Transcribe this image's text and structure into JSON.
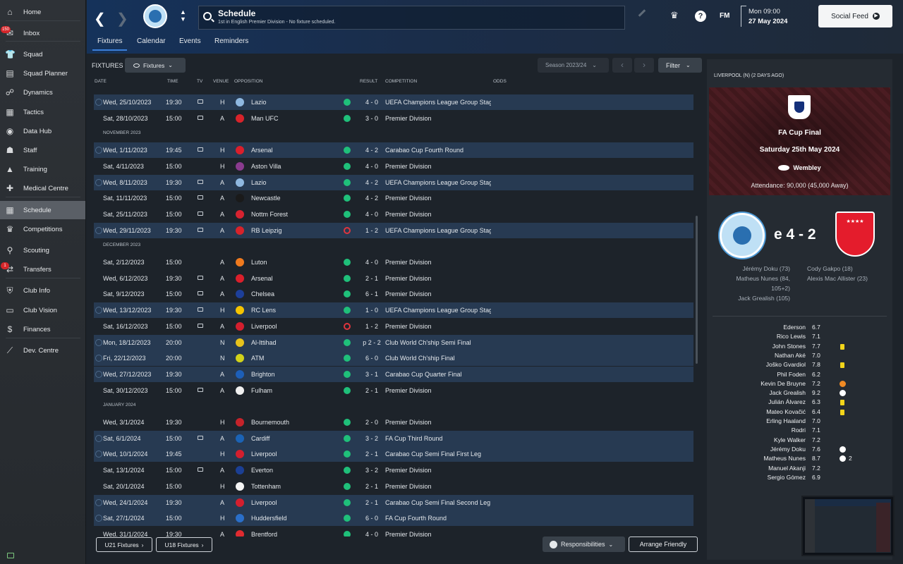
{
  "sidebar": {
    "items": [
      {
        "label": "Home",
        "icon": "home-icon"
      },
      {
        "label": "Inbox",
        "icon": "inbox-icon",
        "badge": "150"
      },
      {
        "label": "Squad",
        "icon": "squad-icon"
      },
      {
        "label": "Squad Planner",
        "icon": "squad-planner-icon"
      },
      {
        "label": "Dynamics",
        "icon": "dynamics-icon"
      },
      {
        "label": "Tactics",
        "icon": "tactics-icon"
      },
      {
        "label": "Data Hub",
        "icon": "data-hub-icon"
      },
      {
        "label": "Staff",
        "icon": "staff-icon"
      },
      {
        "label": "Training",
        "icon": "training-icon"
      },
      {
        "label": "Medical Centre",
        "icon": "medical-icon"
      },
      {
        "label": "Schedule",
        "icon": "schedule-icon",
        "active": true
      },
      {
        "label": "Competitions",
        "icon": "trophy-icon"
      },
      {
        "label": "Scouting",
        "icon": "scouting-icon"
      },
      {
        "label": "Transfers",
        "icon": "transfers-icon",
        "badge": "1"
      },
      {
        "label": "Club Info",
        "icon": "shield-icon"
      },
      {
        "label": "Club Vision",
        "icon": "vision-icon"
      },
      {
        "label": "Finances",
        "icon": "finances-icon"
      },
      {
        "label": "Dev. Centre",
        "icon": "dev-centre-icon"
      }
    ]
  },
  "header": {
    "title": "Schedule",
    "subtitle": "1st in English Premier Division - No fixture scheduled.",
    "fm_logo": "FM",
    "date_time": "Mon 09:00",
    "date_day": "27 May 2024",
    "social_feed": "Social Feed",
    "help": "?"
  },
  "tabs": [
    "Fixtures",
    "Calendar",
    "Events",
    "Reminders"
  ],
  "toolbar": {
    "fixtures_label": "FIXTURES",
    "fixtures_dropdown": "Fixtures",
    "season": "Season 2023/24",
    "filter": "Filter"
  },
  "columns": {
    "date": "DATE",
    "time": "TIME",
    "tv": "TV",
    "venue": "VENUE",
    "opposition": "OPPOSITION",
    "result": "RESULT",
    "competition": "COMPETITION",
    "odds": "ODDS"
  },
  "fixtures": [
    {
      "date": "Wed, 25/10/2023",
      "time": "19:30",
      "tv": true,
      "venue": "H",
      "opp": "Lazio",
      "res": "W",
      "score": "4 - 0",
      "comp": "UEFA Champions League Group Stage",
      "hl": true,
      "badge": "#8fb8e0"
    },
    {
      "date": "Sat, 28/10/2023",
      "time": "15:00",
      "tv": true,
      "venue": "A",
      "opp": "Man UFC",
      "res": "W",
      "score": "3 - 0",
      "comp": "Premier Division",
      "hl": false,
      "badge": "#d8232a"
    },
    {
      "month": "NOVEMBER 2023"
    },
    {
      "date": "Wed, 1/11/2023",
      "time": "19:45",
      "tv": true,
      "venue": "H",
      "opp": "Arsenal",
      "res": "W",
      "score": "4 - 2",
      "comp": "Carabao Cup Fourth Round",
      "hl": true,
      "badge": "#db1f2b"
    },
    {
      "date": "Sat, 4/11/2023",
      "time": "15:00",
      "tv": false,
      "venue": "H",
      "opp": "Aston Villa",
      "res": "W",
      "score": "4 - 0",
      "comp": "Premier Division",
      "hl": false,
      "badge": "#8a3b8f"
    },
    {
      "date": "Wed, 8/11/2023",
      "time": "19:30",
      "tv": true,
      "venue": "A",
      "opp": "Lazio",
      "res": "W",
      "score": "4 - 2",
      "comp": "UEFA Champions League Group Stage",
      "hl": true,
      "badge": "#8fb8e0"
    },
    {
      "date": "Sat, 11/11/2023",
      "time": "15:00",
      "tv": true,
      "venue": "A",
      "opp": "Newcastle",
      "res": "W",
      "score": "4 - 2",
      "comp": "Premier Division",
      "hl": false,
      "badge": "#1a1a1a"
    },
    {
      "date": "Sat, 25/11/2023",
      "time": "15:00",
      "tv": true,
      "venue": "A",
      "opp": "Nottm Forest",
      "res": "W",
      "score": "4 - 0",
      "comp": "Premier Division",
      "hl": false,
      "badge": "#d72330"
    },
    {
      "date": "Wed, 29/11/2023",
      "time": "19:30",
      "tv": true,
      "venue": "A",
      "opp": "RB Leipzig",
      "res": "L",
      "score": "1 - 2",
      "comp": "UEFA Champions League Group Stage",
      "hl": true,
      "badge": "#d8232a"
    },
    {
      "month": "DECEMBER 2023"
    },
    {
      "date": "Sat, 2/12/2023",
      "time": "15:00",
      "tv": false,
      "venue": "A",
      "opp": "Luton",
      "res": "W",
      "score": "4 - 0",
      "comp": "Premier Division",
      "hl": false,
      "badge": "#f07a1e"
    },
    {
      "date": "Wed, 6/12/2023",
      "time": "19:30",
      "tv": true,
      "venue": "A",
      "opp": "Arsenal",
      "res": "W",
      "score": "2 - 1",
      "comp": "Premier Division",
      "hl": false,
      "badge": "#db1f2b"
    },
    {
      "date": "Sat, 9/12/2023",
      "time": "15:00",
      "tv": true,
      "venue": "A",
      "opp": "Chelsea",
      "res": "W",
      "score": "6 - 1",
      "comp": "Premier Division",
      "hl": false,
      "badge": "#1d3f9a"
    },
    {
      "date": "Wed, 13/12/2023",
      "time": "19:30",
      "tv": true,
      "venue": "H",
      "opp": "RC Lens",
      "res": "W",
      "score": "1 - 0",
      "comp": "UEFA Champions League Group Stage",
      "hl": true,
      "badge": "#f5c400"
    },
    {
      "date": "Sat, 16/12/2023",
      "time": "15:00",
      "tv": true,
      "venue": "A",
      "opp": "Liverpool",
      "res": "L",
      "score": "1 - 2",
      "comp": "Premier Division",
      "hl": false,
      "badge": "#d41f2e"
    },
    {
      "date": "Mon, 18/12/2023",
      "time": "20:00",
      "tv": false,
      "venue": "N",
      "opp": "Al-Ittihad",
      "res": "W",
      "score": "p 2 - 2",
      "comp": "Club World Ch'ship Semi Final",
      "hl": true,
      "badge": "#e7c21c"
    },
    {
      "date": "Fri, 22/12/2023",
      "time": "20:00",
      "tv": false,
      "venue": "N",
      "opp": "ATM",
      "res": "W",
      "score": "6 - 0",
      "comp": "Club World Ch'ship Final",
      "hl": true,
      "badge": "#d2d21a"
    },
    {
      "date": "Wed, 27/12/2023",
      "time": "19:30",
      "tv": false,
      "venue": "A",
      "opp": "Brighton",
      "res": "W",
      "score": "3 - 1",
      "comp": "Carabao Cup Quarter Final",
      "hl": true,
      "badge": "#1d5fb8"
    },
    {
      "date": "Sat, 30/12/2023",
      "time": "15:00",
      "tv": true,
      "venue": "A",
      "opp": "Fulham",
      "res": "W",
      "score": "2 - 1",
      "comp": "Premier Division",
      "hl": false,
      "badge": "#f0f0f0"
    },
    {
      "month": "JANUARY 2024"
    },
    {
      "date": "Wed, 3/1/2024",
      "time": "19:30",
      "tv": false,
      "venue": "H",
      "opp": "Bournemouth",
      "res": "W",
      "score": "2 - 0",
      "comp": "Premier Division",
      "hl": false,
      "badge": "#c5232a"
    },
    {
      "date": "Sat, 6/1/2024",
      "time": "15:00",
      "tv": true,
      "venue": "A",
      "opp": "Cardiff",
      "res": "W",
      "score": "3 - 2",
      "comp": "FA Cup Third Round",
      "hl": true,
      "badge": "#1b63b5"
    },
    {
      "date": "Wed, 10/1/2024",
      "time": "19:45",
      "tv": false,
      "venue": "H",
      "opp": "Liverpool",
      "res": "W",
      "score": "2 - 1",
      "comp": "Carabao Cup Semi Final First Leg",
      "hl": true,
      "badge": "#d41f2e"
    },
    {
      "date": "Sat, 13/1/2024",
      "time": "15:00",
      "tv": true,
      "venue": "A",
      "opp": "Everton",
      "res": "W",
      "score": "3 - 2",
      "comp": "Premier Division",
      "hl": false,
      "badge": "#1b3f94"
    },
    {
      "date": "Sat, 20/1/2024",
      "time": "15:00",
      "tv": false,
      "venue": "H",
      "opp": "Tottenham",
      "res": "W",
      "score": "2 - 1",
      "comp": "Premier Division",
      "hl": false,
      "badge": "#f4f4f4"
    },
    {
      "date": "Wed, 24/1/2024",
      "time": "19:30",
      "tv": false,
      "venue": "A",
      "opp": "Liverpool",
      "res": "W",
      "score": "2 - 1",
      "comp": "Carabao Cup Semi Final Second Leg",
      "hl": true,
      "badge": "#d41f2e"
    },
    {
      "date": "Sat, 27/1/2024",
      "time": "15:00",
      "tv": false,
      "venue": "H",
      "opp": "Huddersfield",
      "res": "W",
      "score": "6 - 0",
      "comp": "FA Cup Fourth Round",
      "hl": true,
      "badge": "#2a6fc9"
    },
    {
      "date": "Wed, 31/1/2024",
      "time": "19:30",
      "tv": false,
      "venue": "A",
      "opp": "Brentford",
      "res": "W",
      "score": "4 - 0",
      "comp": "Premier Division",
      "hl": false,
      "badge": "#e02b30"
    }
  ],
  "footer": {
    "u21": "U21 Fixtures",
    "u18": "U18 Fixtures",
    "responsibilities": "Responsibilities",
    "arrange": "Arrange Friendly"
  },
  "right_panel": {
    "title": "LIVERPOOL (N) (2 DAYS AGO)",
    "competition": "FA Cup Final",
    "date": "Saturday 25th May 2024",
    "venue": "Wembley",
    "attendance": "Attendance: 90,000 (45,000 Away)",
    "score": "e 4 - 2",
    "home_scorers": [
      "Jérémy Doku (73)",
      "Matheus Nunes (84,",
      "105+2)",
      "Jack Grealish (105)"
    ],
    "away_scorers": [
      "Cody Gakpo (18)",
      "Alexis Mac Allister (23)"
    ],
    "lineup": [
      {
        "name": "Ederson",
        "rating": "6.7",
        "icon": ""
      },
      {
        "name": "Rico Lewis",
        "rating": "7.1",
        "icon": ""
      },
      {
        "name": "John Stones",
        "rating": "7.7",
        "icon": "yellow"
      },
      {
        "name": "Nathan Aké",
        "rating": "7.0",
        "icon": ""
      },
      {
        "name": "Joško Gvardiol",
        "rating": "7.8",
        "icon": "yellow"
      },
      {
        "name": "Phil Foden",
        "rating": "6.2",
        "icon": ""
      },
      {
        "name": "Kevin De Bruyne",
        "rating": "7.2",
        "icon": "sub"
      },
      {
        "name": "Jack Grealish",
        "rating": "9.2",
        "icon": "ball"
      },
      {
        "name": "Julián Álvarez",
        "rating": "6.3",
        "icon": "yellow"
      },
      {
        "name": "Mateo Kovačić",
        "rating": "6.4",
        "icon": "yellow"
      },
      {
        "name": "Erling Haaland",
        "rating": "7.0",
        "icon": ""
      },
      {
        "name": "Rodri",
        "rating": "7.1",
        "icon": ""
      },
      {
        "name": "Kyle Walker",
        "rating": "7.2",
        "icon": ""
      },
      {
        "name": "Jérémy Doku",
        "rating": "7.6",
        "icon": "ball"
      },
      {
        "name": "Matheus Nunes",
        "rating": "8.7",
        "icon": "ball",
        "goals": "2"
      },
      {
        "name": "Manuel Akanji",
        "rating": "7.2",
        "icon": ""
      },
      {
        "name": "Sergio Gómez",
        "rating": "6.9",
        "icon": ""
      }
    ]
  }
}
